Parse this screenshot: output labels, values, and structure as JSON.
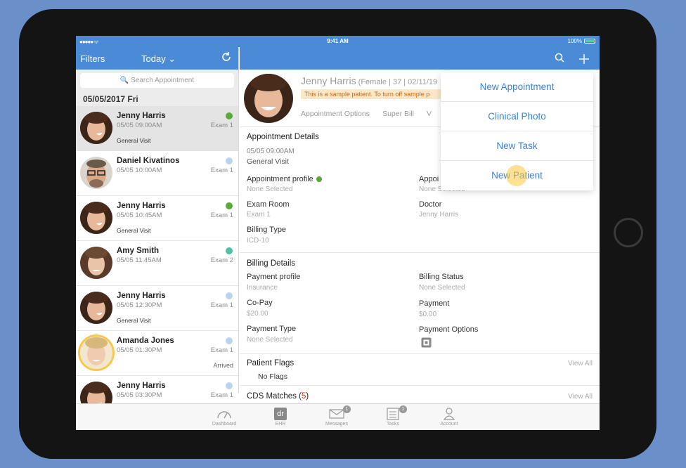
{
  "status_bar": {
    "signal": "●●●●● ᯤ",
    "time": "9:41 AM",
    "battery": "100%"
  },
  "left_nav": {
    "filters": "Filters",
    "today": "Today ⌄"
  },
  "search": {
    "placeholder": "🔍 Search Appointment"
  },
  "date_header": "05/05/2017 Fri",
  "appointments": [
    {
      "name": "Jenny Harris",
      "when": "05/05 09:00AM",
      "room": "Exam 1",
      "kind": "General Visit",
      "status": "",
      "dot": "#5aaa3a"
    },
    {
      "name": "Daniel Kivatinos",
      "when": "05/05 10:00AM",
      "room": "Exam 1",
      "kind": "",
      "status": "",
      "dot": "#bcd3ef"
    },
    {
      "name": "Jenny Harris",
      "when": "05/05 10:45AM",
      "room": "Exam 1",
      "kind": "General Visit",
      "status": "",
      "dot": "#5aaa3a"
    },
    {
      "name": "Amy Smith",
      "when": "05/05 11:45AM",
      "room": "Exam 2",
      "kind": "",
      "status": "",
      "dot": "#4cc3a3"
    },
    {
      "name": "Jenny Harris",
      "when": "05/05 12:30PM",
      "room": "Exam 1",
      "kind": "General Visit",
      "status": "",
      "dot": "#bcd3ef"
    },
    {
      "name": "Amanda Jones",
      "when": "05/05 01:30PM",
      "room": "Exam 1",
      "kind": "",
      "status": "Arrived",
      "dot": "#bcd3ef"
    },
    {
      "name": "Jenny Harris",
      "when": "05/05 03:30PM",
      "room": "Exam 1",
      "kind": "",
      "status": "",
      "dot": "#bcd3ef"
    }
  ],
  "patient": {
    "name": "Jenny Harris",
    "meta": " (Female | 37 | 02/11/19",
    "sample_notice": "This is a sample patient. To turn off sample p",
    "tabs": [
      "Appointment Options",
      "Super Bill",
      "V"
    ]
  },
  "appointment_details": {
    "title": "Appointment Details",
    "datetime": "05/05 09:00AM",
    "visit": "General Visit",
    "profile_label": "Appointment profile",
    "profile_value": "None Selected",
    "appoi_label": "Appoi",
    "appoi_value": "None Selected",
    "exam_room_label": "Exam Room",
    "exam_room_value": "Exam 1",
    "doctor_label": "Doctor",
    "doctor_value": "Jenny Harris",
    "billing_type_label": "Billing Type",
    "billing_type_value": "ICD-10"
  },
  "billing_details": {
    "title": "Billing Details",
    "payment_profile_label": "Payment profile",
    "payment_profile_value": "Insurance",
    "billing_status_label": "Billing Status",
    "billing_status_value": "None Selected",
    "copay_label": "Co-Pay",
    "copay_value": "$20.00",
    "payment_label": "Payment",
    "payment_value": "$0.00",
    "payment_type_label": "Payment Type",
    "payment_type_value": "None Selected",
    "payment_options_label": "Payment Options"
  },
  "patient_flags": {
    "title": "Patient Flags",
    "value": "No Flags",
    "view_all": "View All"
  },
  "cds_matches": {
    "title": "CDS Matches (",
    "count": "5",
    "close": ")",
    "view_all": "View All"
  },
  "dropdown": [
    "New Appointment",
    "Clinical Photo",
    "New Task",
    "New Patient"
  ],
  "tabbar": [
    {
      "label": "Dashboard",
      "icon": "dashboard-icon",
      "badge": ""
    },
    {
      "label": "EHR",
      "icon": "ehr-icon",
      "badge": ""
    },
    {
      "label": "Messages",
      "icon": "messages-icon",
      "badge": "1"
    },
    {
      "label": "Tasks",
      "icon": "tasks-icon",
      "badge": "1"
    },
    {
      "label": "Account",
      "icon": "account-icon",
      "badge": ""
    }
  ],
  "colors": {
    "nav_blue": "#4a8ad6",
    "link_blue": "#3a82d6",
    "notice_bg": "#fbe7c9",
    "cds_count": "#d0342c"
  }
}
